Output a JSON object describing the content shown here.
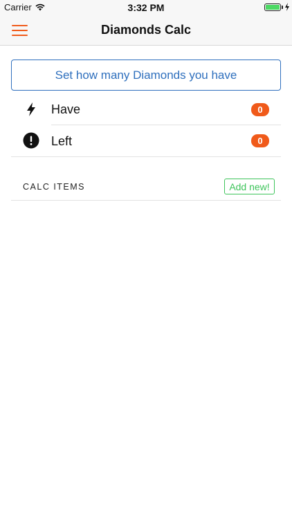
{
  "status_bar": {
    "carrier": "Carrier",
    "time": "3:32 PM",
    "battery_color": "#4cd964"
  },
  "nav": {
    "title": "Diamonds Calc",
    "menu_icon": "hamburger-menu-icon",
    "accent": "#f05a1a"
  },
  "set_button_label": "Set how many Diamonds you have",
  "stats": [
    {
      "icon": "lightning-bolt-icon",
      "label": "Have",
      "value": "0"
    },
    {
      "icon": "exclamation-circle-icon",
      "label": "Left",
      "value": "0"
    }
  ],
  "calc_section": {
    "title": "CALC ITEMS",
    "add_label": "Add new!"
  }
}
